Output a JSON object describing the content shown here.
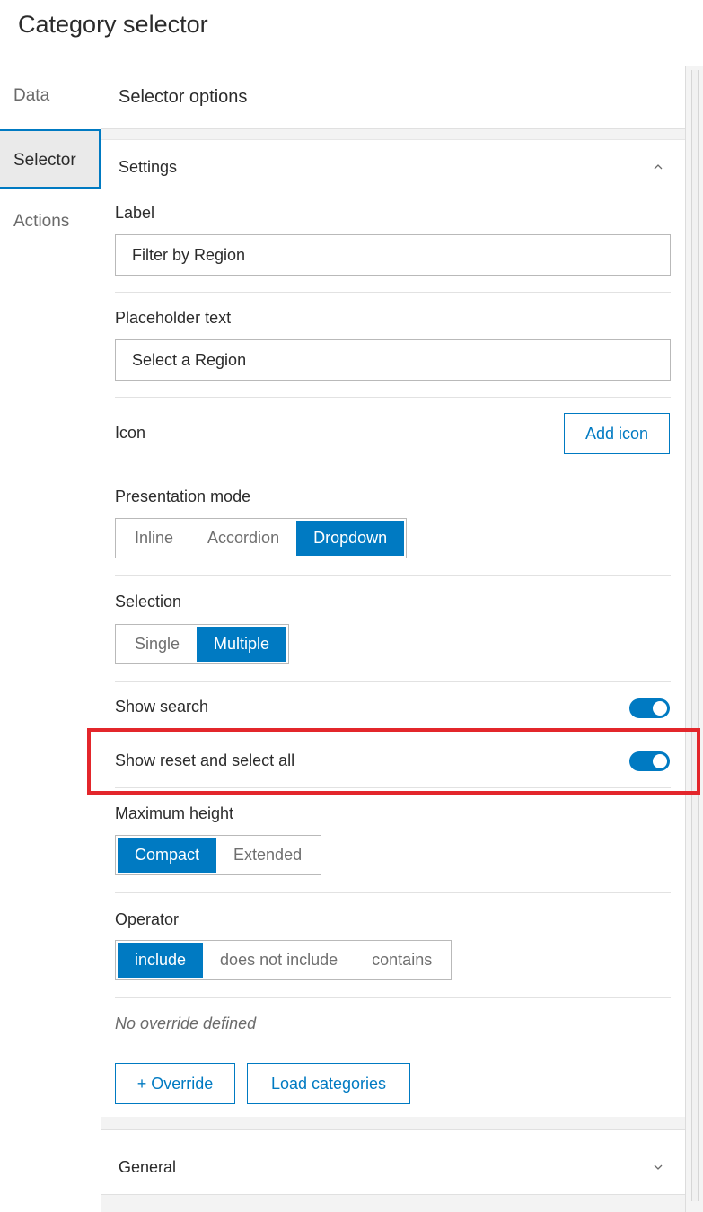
{
  "window": {
    "title": "Category selector"
  },
  "tabs": [
    {
      "label": "Data"
    },
    {
      "label": "Selector"
    },
    {
      "label": "Actions"
    }
  ],
  "panel": {
    "header": "Selector options",
    "settings": {
      "title": "Settings",
      "label_field": {
        "label": "Label",
        "value": "Filter by Region"
      },
      "placeholder_field": {
        "label": "Placeholder text",
        "value": "Select a Region"
      },
      "icon": {
        "label": "Icon",
        "button": "Add icon"
      },
      "presentation_mode": {
        "label": "Presentation mode",
        "options": [
          "Inline",
          "Accordion",
          "Dropdown"
        ],
        "selected": "Dropdown"
      },
      "selection": {
        "label": "Selection",
        "options": [
          "Single",
          "Multiple"
        ],
        "selected": "Multiple"
      },
      "show_search": {
        "label": "Show search",
        "on": true
      },
      "show_reset": {
        "label": "Show reset and select all",
        "on": true
      },
      "maximum_height": {
        "label": "Maximum height",
        "options": [
          "Compact",
          "Extended"
        ],
        "selected": "Compact"
      },
      "operator": {
        "label": "Operator",
        "options": [
          "include",
          "does not include",
          "contains"
        ],
        "selected": "include"
      },
      "override_note": "No override defined",
      "override_button": "+ Override",
      "load_button": "Load categories"
    },
    "general": {
      "title": "General"
    }
  },
  "colors": {
    "accent": "#007ac2",
    "highlight": "#e3262b"
  },
  "icons": {
    "settings_chevron": "chevron-up-icon",
    "general_chevron": "chevron-down-icon"
  }
}
